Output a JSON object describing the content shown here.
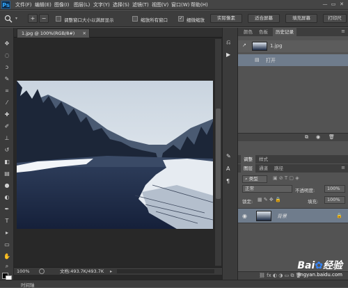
{
  "app": {
    "logo": "Ps"
  },
  "menu": [
    "文件(F)",
    "编辑(E)",
    "图像(I)",
    "图层(L)",
    "文字(Y)",
    "选择(S)",
    "滤镜(T)",
    "视图(V)",
    "窗口(W)",
    "帮助(H)"
  ],
  "window_controls": {
    "minimize": "—",
    "restore": "▭",
    "close": "✕"
  },
  "options": {
    "zoom_in": "+",
    "zoom_out": "−",
    "resize_windows_label": "调整窗口大小以满屏显示",
    "zoom_all_label": "缩放所有窗口",
    "scrubby_zoom_label": "细微缩放",
    "actual_pixels": "实际像素",
    "fit_screen": "适合屏幕",
    "fill_screen": "填充屏幕",
    "print_size": "打印尺"
  },
  "document": {
    "tab_title": "1.jpg @ 100%(RGB/8#)",
    "close": "✕"
  },
  "status": {
    "zoom": "100%",
    "doc_info": "文档:493.7K/493.7K"
  },
  "history_panel": {
    "tabs": [
      "颜色",
      "色板",
      "历史记录"
    ],
    "snapshot_name": "1.jpg",
    "state_open": "打开"
  },
  "layers_panel": {
    "top_tabs": [
      "调整",
      "样式"
    ],
    "tabs": [
      "图层",
      "通道",
      "路径"
    ],
    "filter_kind": "类型",
    "blend_mode": "正常",
    "opacity_label": "不透明度:",
    "opacity_value": "100%",
    "lock_label": "锁定:",
    "fill_label": "填充:",
    "fill_value": "100%",
    "layer_name": "背景"
  },
  "timeline": {
    "label": "时间轴"
  },
  "watermark": {
    "brand": "Bai",
    "brand2": "经验",
    "url": "jingyan.baidu.com"
  },
  "colors": {
    "accent": "#31a8ff",
    "sky": "#dfe6ee",
    "water": "#1d2b45",
    "forest": "#1a2536"
  }
}
